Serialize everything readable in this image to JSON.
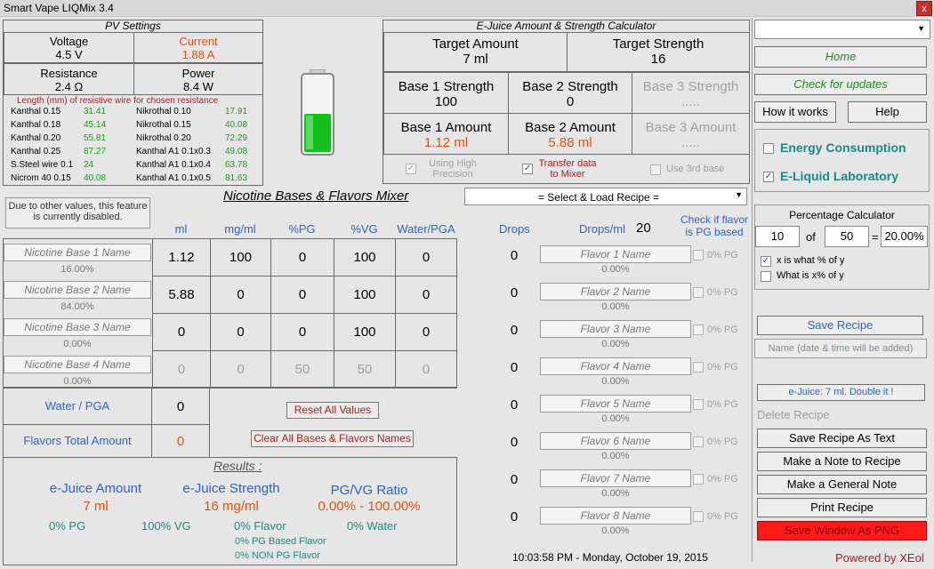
{
  "app": {
    "title": "Smart Vape LIQMix  3.4",
    "close": "x"
  },
  "pv": {
    "title": "PV  Settings",
    "voltage_label": "Voltage",
    "voltage": "4.5 V",
    "current_label": "Current",
    "current": "1.88 A",
    "resistance_label": "Resistance",
    "resistance": "2.4 Ω",
    "power_label": "Power",
    "power": "8.4 W",
    "wire_title": "Length (mm) of resistive wire for chosen resistance",
    "wires": [
      [
        "Kanthal 0.15",
        "31.41",
        "Nikrothal 0.10",
        "17.91"
      ],
      [
        "Kanthal 0.18",
        "45.14",
        "Nikrothal 0.15",
        "40.08"
      ],
      [
        "Kanthal 0.20",
        "55.81",
        "Nikrothal 0.20",
        "72.29"
      ],
      [
        "Kanthal 0.25",
        "87.27",
        "Kanthal A1 0.1x0.3",
        "49.08"
      ],
      [
        "S.Steel wire 0.1",
        "24",
        "Kanthal A1 0.1x0.4",
        "63.78"
      ],
      [
        "Nicrom 40 0.15",
        "40.08",
        "Kanthal A1 0.1x0.5",
        "81.63"
      ]
    ]
  },
  "calc": {
    "title": "E-Juice Amount & Strength Calculator",
    "target_amount_label": "Target Amount",
    "target_amount": "7 ml",
    "target_strength_label": "Target Strength",
    "target_strength": "16",
    "b1s_label": "Base 1 Strength",
    "b1s": "100",
    "b2s_label": "Base 2 Strength",
    "b2s": "0",
    "b3s_label": "Base 3 Strength",
    "b3s": ".....",
    "b1a_label": "Base 1 Amount",
    "b1a": "1.12  ml",
    "b2a_label": "Base 2 Amount",
    "b2a": "5.88  ml",
    "b3a_label": "Base 3 Amount",
    "b3a": ".....",
    "opt1": "Using High Precision",
    "opt2": "Transfer data to Mixer",
    "opt3": "Use 3rd base"
  },
  "mixer": {
    "title": "Nicotine Bases & Flavors Mixer",
    "recipe_select": "= Select & Load Recipe =",
    "disabled_note": "Due to other values, this feature is currently disabled.",
    "cols": [
      "ml",
      "mg/ml",
      "%PG",
      "%VG",
      "Water/PGA"
    ],
    "drops_label": "Drops",
    "drops_ml_label": "Drops/ml",
    "drops_ml": "20",
    "check_pg_label": "Check if flavor is PG based",
    "bases": [
      {
        "name": "Nicotine Base 1 Name",
        "pct": "16.00%",
        "ml": "1.12",
        "mg": "100",
        "pg": "0",
        "vg": "100",
        "water": "0"
      },
      {
        "name": "Nicotine Base 2 Name",
        "pct": "84.00%",
        "ml": "5.88",
        "mg": "0",
        "pg": "0",
        "vg": "100",
        "water": "0"
      },
      {
        "name": "Nicotine Base 3 Name",
        "pct": "0.00%",
        "ml": "0",
        "mg": "0",
        "pg": "0",
        "vg": "100",
        "water": "0"
      },
      {
        "name": "Nicotine Base 4 Name",
        "pct": "0.00%",
        "ml": "0",
        "mg": "0",
        "pg": "50",
        "vg": "50",
        "water": "0"
      }
    ],
    "water_label": "Water / PGA",
    "water_val": "0",
    "flavors_total_label": "Flavors Total Amount",
    "flavors_total": "0",
    "reset": "Reset All Values",
    "clear": "Clear All Bases & Flavors Names",
    "flavors": [
      {
        "drops": "0",
        "name": "Flavor 1 Name",
        "pct": "0.00%",
        "pg": "0% PG"
      },
      {
        "drops": "0",
        "name": "Flavor 2 Name",
        "pct": "0.00%",
        "pg": "0% PG"
      },
      {
        "drops": "0",
        "name": "Flavor 3 Name",
        "pct": "0.00%",
        "pg": "0% PG"
      },
      {
        "drops": "0",
        "name": "Flavor 4 Name",
        "pct": "0.00%",
        "pg": "0% PG"
      },
      {
        "drops": "0",
        "name": "Flavor 5 Name",
        "pct": "0.00%",
        "pg": "0% PG"
      },
      {
        "drops": "0",
        "name": "Flavor 6 Name",
        "pct": "0.00%",
        "pg": "0% PG"
      },
      {
        "drops": "0",
        "name": "Flavor 7 Name",
        "pct": "0.00%",
        "pg": "0% PG"
      },
      {
        "drops": "0",
        "name": "Flavor 8 Name",
        "pct": "0.00%",
        "pg": "0% PG"
      }
    ]
  },
  "results": {
    "title": "Results :",
    "amount_label": "e-Juice Amount",
    "amount": "7 ml",
    "strength_label": "e-Juice Strength",
    "strength": "16 mg/ml",
    "ratio_label": "PG/VG Ratio",
    "ratio": "0.00% - 100.00%",
    "pg": "0% PG",
    "vg": "100% VG",
    "flavor": "0% Flavor",
    "water": "0% Water",
    "pg_flavor": "0% PG Based Flavor",
    "non_pg_flavor": "0% NON PG Flavor"
  },
  "status": {
    "datetime": "10:03:58 PM  -  Monday, October 19, 2015"
  },
  "side": {
    "home": "Home",
    "updates": "Check for updates",
    "how": "How it works",
    "help": "Help",
    "energy": "Energy Consumption",
    "lab": "E-Liquid Laboratory",
    "pct_title": "Percentage Calculator",
    "pct_a": "10",
    "pct_of": "of",
    "pct_b": "50",
    "pct_eq": "=",
    "pct_result": "20.00%",
    "pct_opt1": "x is what % of y",
    "pct_opt2": "What is x% of y",
    "save_recipe": "Save Recipe",
    "name_placeholder": "Name (date & time will be added)",
    "ejuice_note": "e-Juice: 7 ml.  Double it !",
    "delete": "Delete Recipe",
    "save_text": "Save Recipe As Text",
    "note_recipe": "Make a Note to Recipe",
    "general_note": "Make a General Note",
    "print": "Print Recipe",
    "save_png": "Save Window As PNG",
    "powered": "Powered by XEol"
  }
}
